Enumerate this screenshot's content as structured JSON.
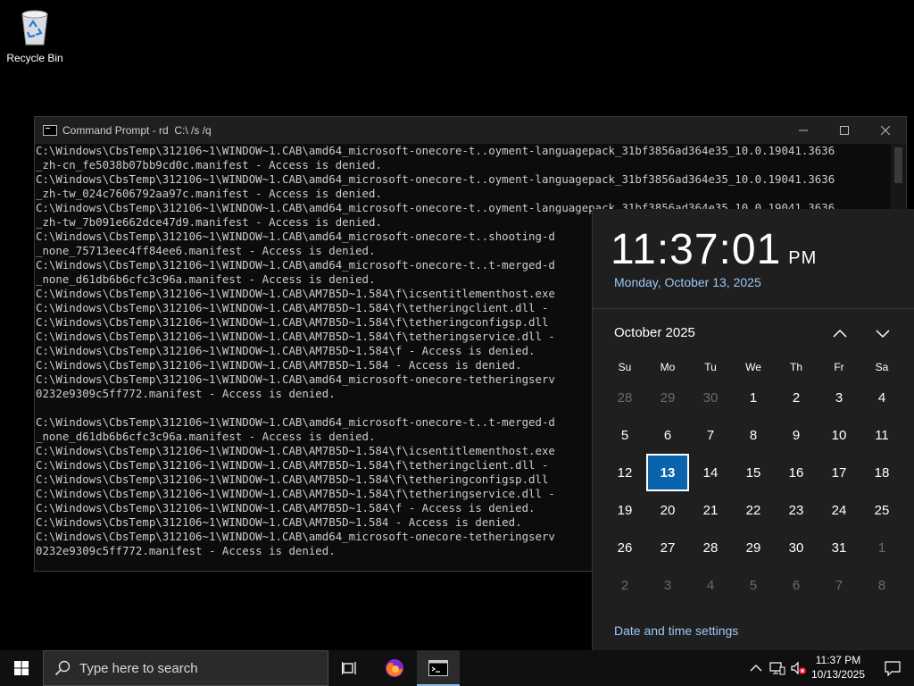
{
  "desktop": {
    "recycle_bin_label": "Recycle Bin",
    "icon": "recycle-bin-icon"
  },
  "cmd": {
    "title": "Command Prompt - rd  C:\\ /s /q",
    "controls": [
      "minimize",
      "maximize",
      "close"
    ],
    "lines": [
      "C:\\Windows\\CbsTemp\\312106~1\\WINDOW~1.CAB\\amd64_microsoft-onecore-t..oyment-languagepack_31bf3856ad364e35_10.0.19041.3636",
      "_zh-cn_fe5038b07bb9cd0c.manifest - Access is denied.",
      "C:\\Windows\\CbsTemp\\312106~1\\WINDOW~1.CAB\\amd64_microsoft-onecore-t..oyment-languagepack_31bf3856ad364e35_10.0.19041.3636",
      "_zh-tw_024c7606792aa97c.manifest - Access is denied.",
      "C:\\Windows\\CbsTemp\\312106~1\\WINDOW~1.CAB\\amd64_microsoft-onecore-t..oyment-languagepack_31bf3856ad364e35_10.0.19041.3636",
      "_zh-tw_7b091e662dce47d9.manifest - Access is denied.",
      "C:\\Windows\\CbsTemp\\312106~1\\WINDOW~1.CAB\\amd64_microsoft-onecore-t..shooting-d",
      "_none_75713eec4ff84ee6.manifest - Access is denied.",
      "C:\\Windows\\CbsTemp\\312106~1\\WINDOW~1.CAB\\amd64_microsoft-onecore-t..t-merged-d",
      "_none_d61db6b6cfc3c96a.manifest - Access is denied.",
      "C:\\Windows\\CbsTemp\\312106~1\\WINDOW~1.CAB\\AM7B5D~1.584\\f\\icsentitlementhost.exe",
      "C:\\Windows\\CbsTemp\\312106~1\\WINDOW~1.CAB\\AM7B5D~1.584\\f\\tetheringclient.dll -",
      "C:\\Windows\\CbsTemp\\312106~1\\WINDOW~1.CAB\\AM7B5D~1.584\\f\\tetheringconfigsp.dll",
      "C:\\Windows\\CbsTemp\\312106~1\\WINDOW~1.CAB\\AM7B5D~1.584\\f\\tetheringservice.dll -",
      "C:\\Windows\\CbsTemp\\312106~1\\WINDOW~1.CAB\\AM7B5D~1.584\\f - Access is denied.",
      "C:\\Windows\\CbsTemp\\312106~1\\WINDOW~1.CAB\\AM7B5D~1.584 - Access is denied.",
      "C:\\Windows\\CbsTemp\\312106~1\\WINDOW~1.CAB\\amd64_microsoft-onecore-tetheringserv",
      "0232e9309c5ff772.manifest - Access is denied.",
      "",
      "C:\\Windows\\CbsTemp\\312106~1\\WINDOW~1.CAB\\amd64_microsoft-onecore-t..t-merged-d",
      "_none_d61db6b6cfc3c96a.manifest - Access is denied.",
      "C:\\Windows\\CbsTemp\\312106~1\\WINDOW~1.CAB\\AM7B5D~1.584\\f\\icsentitlementhost.exe",
      "C:\\Windows\\CbsTemp\\312106~1\\WINDOW~1.CAB\\AM7B5D~1.584\\f\\tetheringclient.dll -",
      "C:\\Windows\\CbsTemp\\312106~1\\WINDOW~1.CAB\\AM7B5D~1.584\\f\\tetheringconfigsp.dll",
      "C:\\Windows\\CbsTemp\\312106~1\\WINDOW~1.CAB\\AM7B5D~1.584\\f\\tetheringservice.dll -",
      "C:\\Windows\\CbsTemp\\312106~1\\WINDOW~1.CAB\\AM7B5D~1.584\\f - Access is denied.",
      "C:\\Windows\\CbsTemp\\312106~1\\WINDOW~1.CAB\\AM7B5D~1.584 - Access is denied.",
      "C:\\Windows\\CbsTemp\\312106~1\\WINDOW~1.CAB\\amd64_microsoft-onecore-tetheringserv",
      "0232e9309c5ff772.manifest - Access is denied."
    ]
  },
  "flyout": {
    "time": "11:37:01",
    "ampm": "PM",
    "date": "Monday, October 13, 2025",
    "month_label": "October 2025",
    "weekdays": [
      "Su",
      "Mo",
      "Tu",
      "We",
      "Th",
      "Fr",
      "Sa"
    ],
    "weeks": [
      [
        [
          "28",
          1
        ],
        [
          "29",
          1
        ],
        [
          "30",
          1
        ],
        [
          "1",
          0
        ],
        [
          "2",
          0
        ],
        [
          "3",
          0
        ],
        [
          "4",
          0
        ]
      ],
      [
        [
          "5",
          0
        ],
        [
          "6",
          0
        ],
        [
          "7",
          0
        ],
        [
          "8",
          0
        ],
        [
          "9",
          0
        ],
        [
          "10",
          0
        ],
        [
          "11",
          0
        ]
      ],
      [
        [
          "12",
          0
        ],
        [
          "13",
          2
        ],
        [
          "14",
          0
        ],
        [
          "15",
          0
        ],
        [
          "16",
          0
        ],
        [
          "17",
          0
        ],
        [
          "18",
          0
        ]
      ],
      [
        [
          "19",
          0
        ],
        [
          "20",
          0
        ],
        [
          "21",
          0
        ],
        [
          "22",
          0
        ],
        [
          "23",
          0
        ],
        [
          "24",
          0
        ],
        [
          "25",
          0
        ]
      ],
      [
        [
          "26",
          0
        ],
        [
          "27",
          0
        ],
        [
          "28",
          0
        ],
        [
          "29",
          0
        ],
        [
          "30",
          0
        ],
        [
          "31",
          0
        ],
        [
          "1",
          1
        ]
      ],
      [
        [
          "2",
          1
        ],
        [
          "3",
          1
        ],
        [
          "4",
          1
        ],
        [
          "5",
          1
        ],
        [
          "6",
          1
        ],
        [
          "7",
          1
        ],
        [
          "8",
          1
        ]
      ]
    ],
    "settings_link": "Date and time settings"
  },
  "taskbar": {
    "search_placeholder": "Type here to search",
    "clock_time": "11:37 PM",
    "clock_date": "10/13/2025",
    "accent": "#8ab8e8"
  }
}
